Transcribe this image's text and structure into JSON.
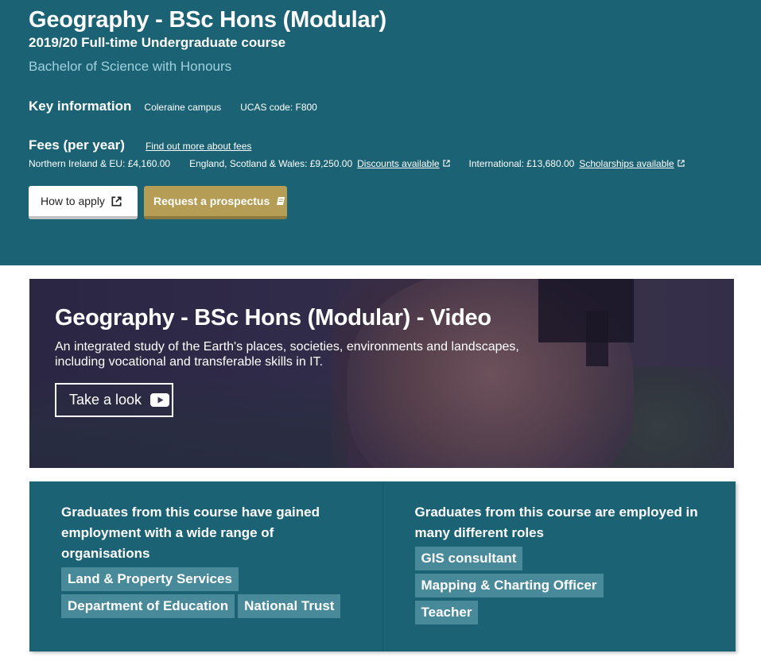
{
  "hero": {
    "title": "Geography - BSc Hons (Modular)",
    "subtitle": "2019/20 Full-time Undergraduate course",
    "award": "Bachelor of Science with Honours",
    "key_info": {
      "heading": "Key information",
      "campus": "Coleraine campus",
      "ucas": "UCAS code: F800"
    },
    "fees": {
      "heading": "Fees (per year)",
      "more_link": "Find out more about fees",
      "ni_eu": "Northern Ireland & EU: £4,160.00",
      "gb": "England, Scotland & Wales: £9,250.00",
      "discounts_link": "Discounts available",
      "international": "International: £13,680.00",
      "scholarships_link": "Scholarships available"
    },
    "buttons": {
      "apply": "How to apply",
      "prospectus": "Request a prospectus"
    }
  },
  "video": {
    "title": "Geography - BSc Hons (Modular) - Video",
    "description": "An integrated study of the Earth's places, societies, environments and landscapes, including vocational and transferable skills in IT.",
    "button": "Take a look"
  },
  "graduates": {
    "employers": {
      "heading": "Graduates from this course have gained employment with a wide range of organisations",
      "tags": [
        "Land & Property Services",
        "Department of Education",
        "National Trust"
      ]
    },
    "roles": {
      "heading": "Graduates from this course are employed in many different roles",
      "tags": [
        "GIS consultant",
        "Mapping & Charting Officer",
        "Teacher"
      ]
    }
  },
  "colors": {
    "teal": "#1b6374",
    "gold": "#b59d55",
    "tag": "#48899a",
    "award_text": "#9fd0de"
  },
  "icons": [
    "external-link-icon",
    "book-icon",
    "youtube-play-icon"
  ]
}
